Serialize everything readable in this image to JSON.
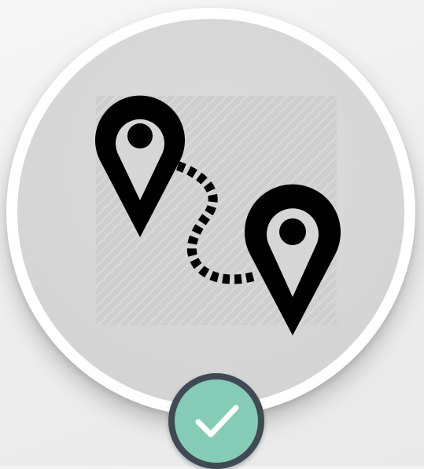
{
  "icon": {
    "name": "route-map-pins-icon",
    "color": "#000000"
  },
  "badge": {
    "name": "checkmark-icon",
    "fill_color": "#86cbb5",
    "ring_color": "#3f4a55",
    "mark_color": "#ffffff"
  },
  "colors": {
    "background": "#f2f2f2",
    "ring": "#ffffff",
    "disc": "#d6d6d6"
  }
}
